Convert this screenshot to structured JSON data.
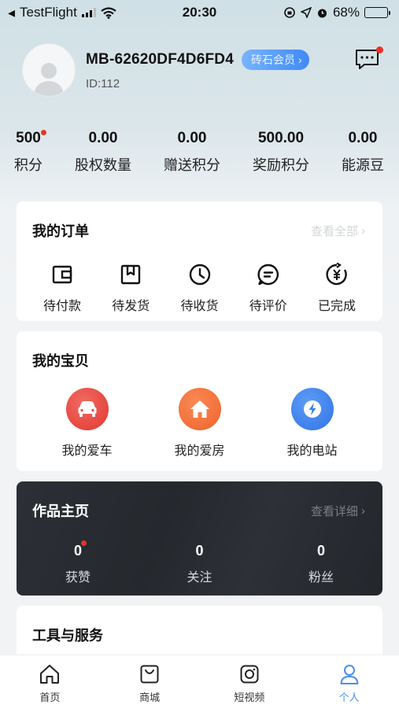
{
  "status_bar": {
    "app": "TestFlight",
    "time": "20:30",
    "battery": "68%",
    "battery_level": 0.68
  },
  "profile": {
    "username": "MB-62620DF4D6FD4",
    "vip_label": "砖石会员",
    "user_id": "ID:112",
    "message_icon": "chat-bubble-icon"
  },
  "stats": [
    {
      "value": "500",
      "label": "积分",
      "has_dot": true
    },
    {
      "value": "0.00",
      "label": "股权数量"
    },
    {
      "value": "0.00",
      "label": "赠送积分"
    },
    {
      "value": "500.00",
      "label": "奖励积分"
    },
    {
      "value": "0.00",
      "label": "能源豆"
    }
  ],
  "orders": {
    "title": "我的订单",
    "more": "查看全部",
    "items": [
      {
        "label": "待付款",
        "icon": "wallet-icon"
      },
      {
        "label": "待发货",
        "icon": "package-icon"
      },
      {
        "label": "待收货",
        "icon": "clock-icon"
      },
      {
        "label": "待评价",
        "icon": "comment-icon"
      },
      {
        "label": "已完成",
        "icon": "yen-refresh-icon"
      }
    ]
  },
  "treasures": {
    "title": "我的宝贝",
    "items": [
      {
        "label": "我的爱车",
        "icon": "car-icon",
        "color": "#ee4a45"
      },
      {
        "label": "我的爱房",
        "icon": "house-icon",
        "color": "#f5743a"
      },
      {
        "label": "我的电站",
        "icon": "lightning-icon",
        "color": "#3d84ef"
      }
    ]
  },
  "works": {
    "title": "作品主页",
    "more": "查看详细",
    "items": [
      {
        "value": "0",
        "label": "获赞",
        "has_dot": true
      },
      {
        "value": "0",
        "label": "关注"
      },
      {
        "value": "0",
        "label": "粉丝"
      }
    ]
  },
  "tools": {
    "title": "工具与服务"
  },
  "tabbar": {
    "items": [
      {
        "label": "首页",
        "icon": "home-icon"
      },
      {
        "label": "商城",
        "icon": "shopping-bag-icon"
      },
      {
        "label": "短视频",
        "icon": "instagram-camera-icon"
      },
      {
        "label": "个人",
        "icon": "person-icon",
        "active": true
      }
    ]
  },
  "colors": {
    "accent": "#4a8ef0",
    "badge_dot": "#e8332a",
    "works_bg": "#2a2d32"
  }
}
